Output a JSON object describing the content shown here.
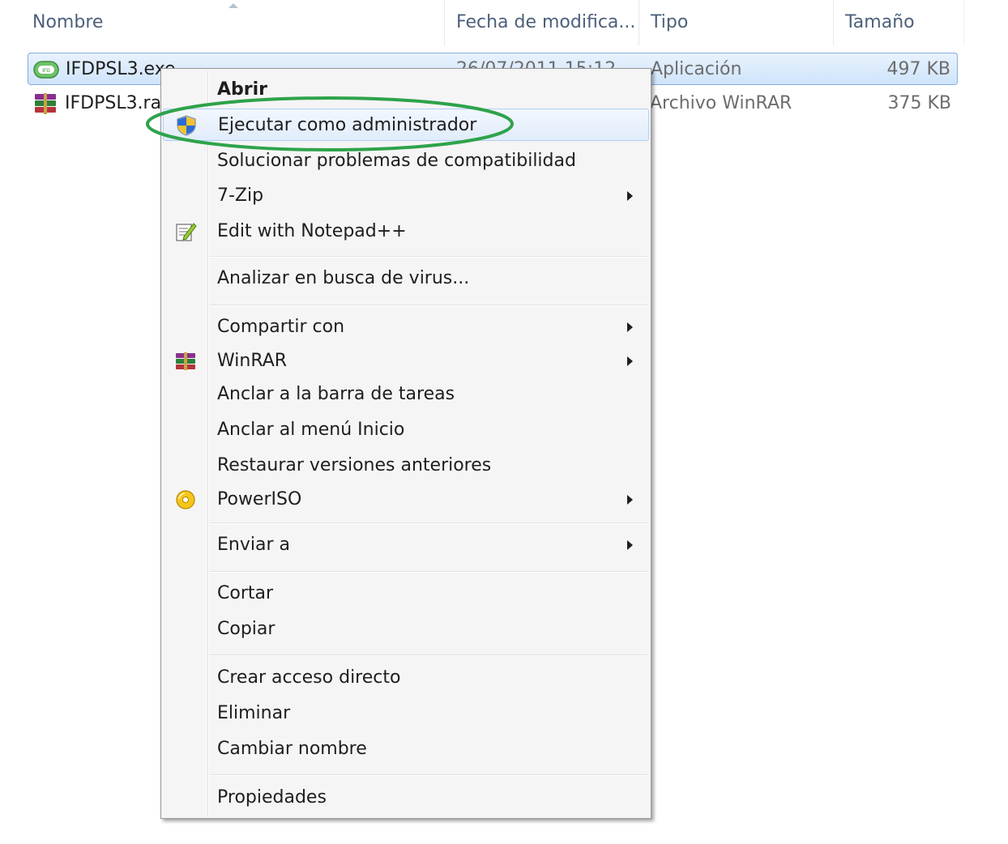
{
  "columns": {
    "name": "Nombre",
    "date": "Fecha de modifica...",
    "type": "Tipo",
    "size": "Tamaño"
  },
  "files": [
    {
      "name": "IFDPSL3.exe",
      "date": "26/07/2011 15:12",
      "type": "Aplicación",
      "size": "497 KB",
      "icon": "app-exe-icon"
    },
    {
      "name": "IFDPSL3.rar",
      "date": "",
      "type": "Archivo WinRAR",
      "size": "375 KB",
      "icon": "winrar-archive-icon"
    }
  ],
  "menu": {
    "items": [
      {
        "label": "Abrir",
        "bold": true
      },
      {
        "label": "Ejecutar como administrador",
        "icon": "uac-shield-icon",
        "highlighted": true
      },
      {
        "label": "Solucionar problemas de compatibilidad"
      },
      {
        "label": "7-Zip",
        "submenu": true
      },
      {
        "label": "Edit with Notepad++",
        "icon": "notepad-plus-plus-icon"
      },
      {
        "label": "Analizar en busca de virus..."
      },
      {
        "label": "Compartir con",
        "submenu": true
      },
      {
        "label": "WinRAR",
        "icon": "winrar-icon",
        "submenu": true
      },
      {
        "label": "Anclar a la barra de tareas"
      },
      {
        "label": "Anclar al menú Inicio"
      },
      {
        "label": "Restaurar versiones anteriores"
      },
      {
        "label": "PowerISO",
        "icon": "poweriso-icon",
        "submenu": true
      },
      {
        "label": "Enviar a",
        "submenu": true
      },
      {
        "label": "Cortar"
      },
      {
        "label": "Copiar"
      },
      {
        "label": "Crear acceso directo"
      },
      {
        "label": "Eliminar"
      },
      {
        "label": "Cambiar nombre"
      },
      {
        "label": "Propiedades"
      }
    ]
  },
  "colors": {
    "selection_border": "#84acdd",
    "annotation": "#2ea34a",
    "header_text": "#4c607a"
  }
}
